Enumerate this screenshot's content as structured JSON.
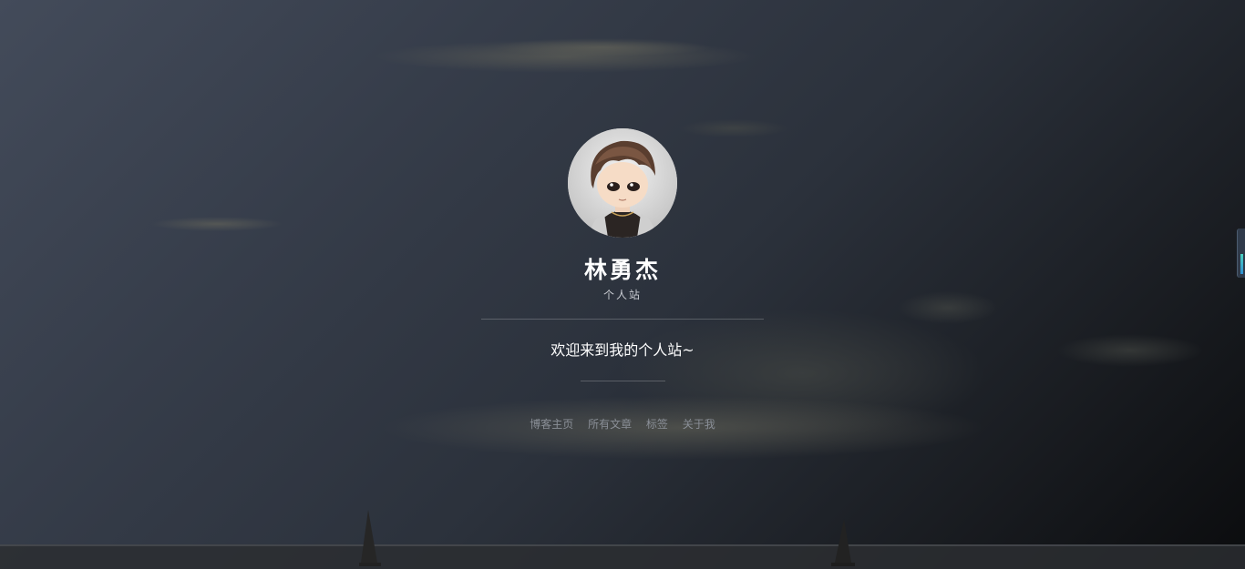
{
  "profile": {
    "name": "林勇杰",
    "subtitle": "个人站",
    "avatar_icon": "cartoon-avatar-icon"
  },
  "welcome_text": "欢迎来到我的个人站~",
  "nav": {
    "items": [
      {
        "label": "博客主页"
      },
      {
        "label": "所有文章"
      },
      {
        "label": "标签"
      },
      {
        "label": "关于我"
      }
    ]
  },
  "colors": {
    "background_top": "#434b5a",
    "background_bottom": "#0b0c0e",
    "title": "#ffffff",
    "nav_link": "#8a8f97"
  }
}
